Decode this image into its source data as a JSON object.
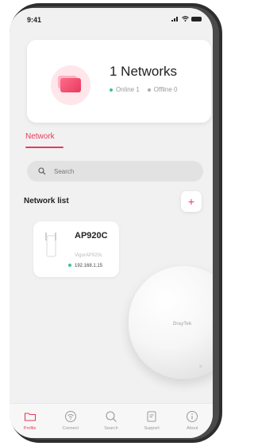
{
  "status_bar": {
    "time": "9:41"
  },
  "summary": {
    "title": "1 Networks",
    "online_text": "Online 1",
    "offline_text": "Offline 0"
  },
  "tabs": [
    {
      "label": "Network",
      "active": true
    }
  ],
  "search": {
    "placeholder": "Search"
  },
  "network_list": {
    "title": "Network list",
    "add_label": "+"
  },
  "devices": [
    {
      "name": "AP920C",
      "subtitle": "VigorAP920c",
      "ip": "192.168.1.15",
      "status": "online"
    }
  ],
  "hero_brand": "DrayTek",
  "bottom_nav": [
    {
      "label": "Profile",
      "icon": "folder-icon",
      "active": true
    },
    {
      "label": "Connect",
      "icon": "wifi-icon",
      "active": false
    },
    {
      "label": "Search",
      "icon": "search-icon",
      "active": false
    },
    {
      "label": "Support",
      "icon": "document-icon",
      "active": false
    },
    {
      "label": "About",
      "icon": "info-icon",
      "active": false
    }
  ],
  "colors": {
    "accent": "#e83a5e",
    "online": "#3cc0a0",
    "offline": "#aaaaaa"
  }
}
